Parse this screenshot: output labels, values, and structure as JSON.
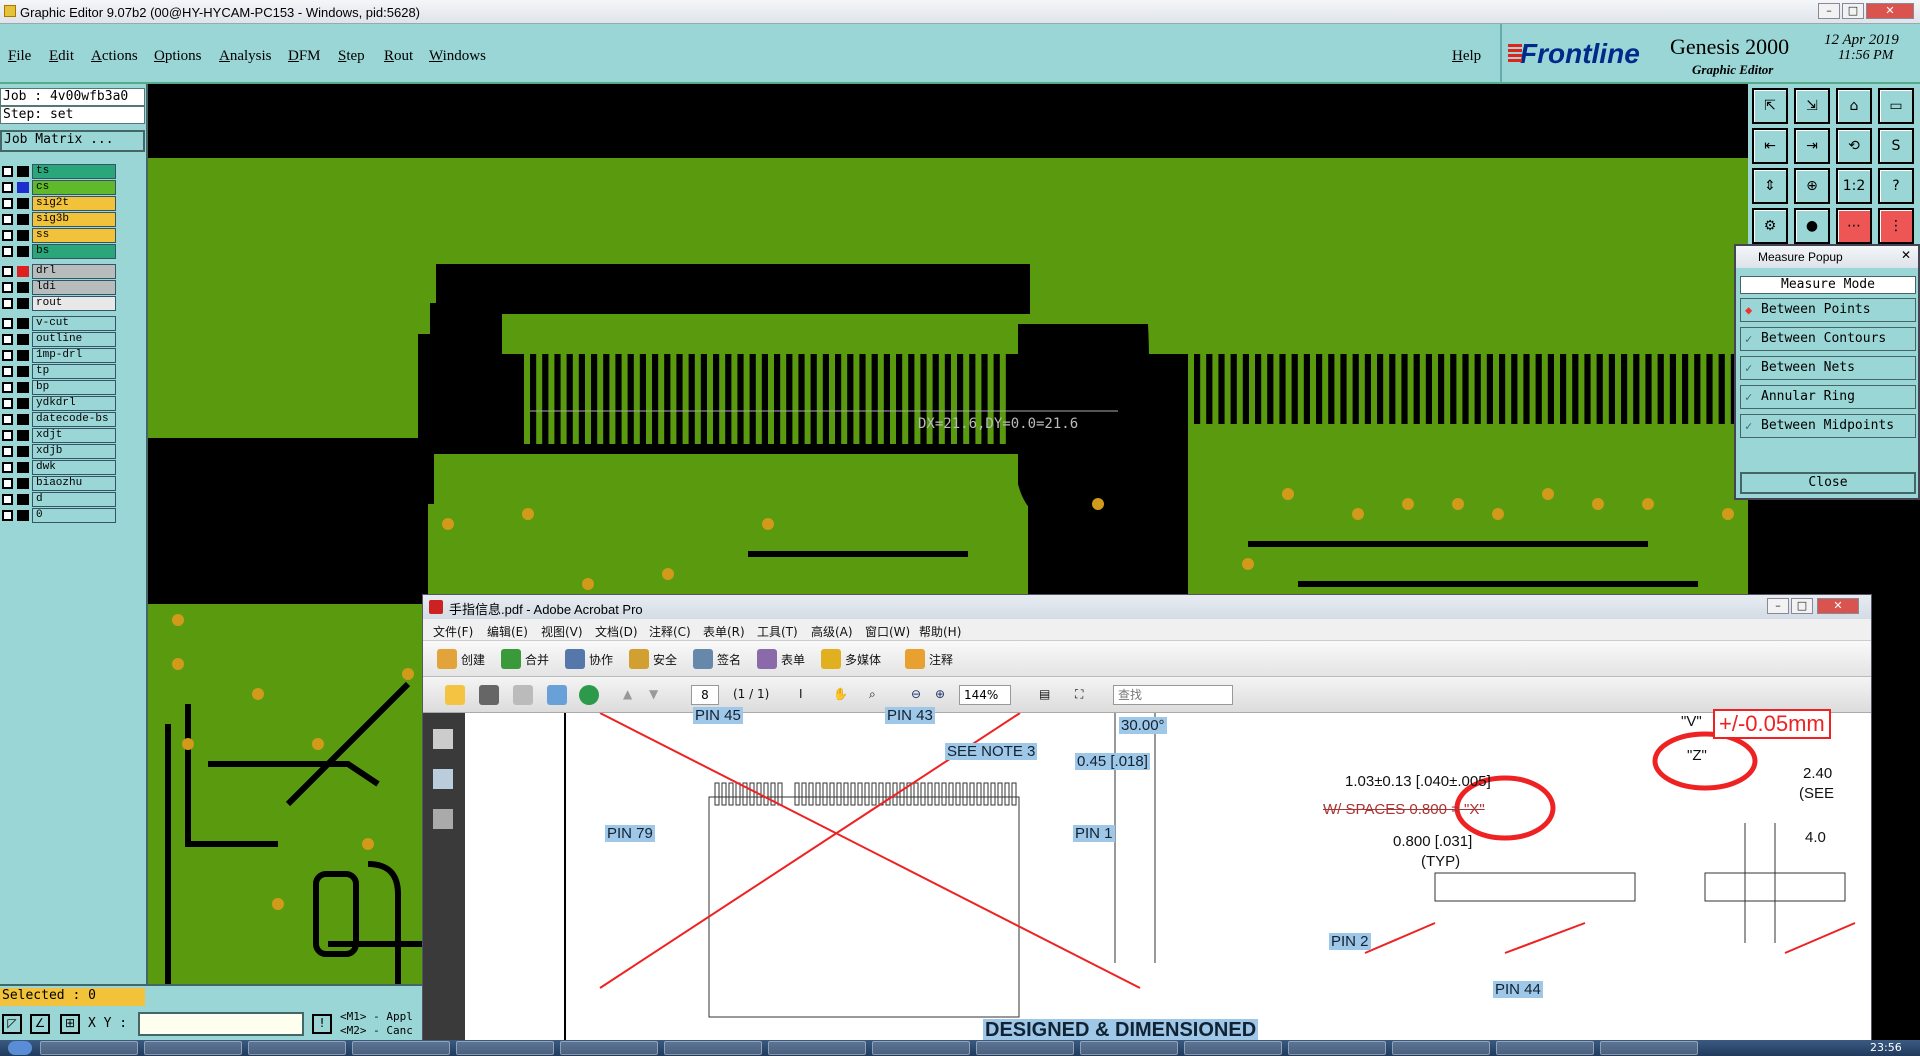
{
  "window": {
    "title": "Graphic Editor 9.07b2 (00@HY-HYCAM-PC153 - Windows, pid:5628)"
  },
  "menu": [
    "File",
    "Edit",
    "Actions",
    "Options",
    "Analysis",
    "DFM",
    "Step",
    "Rout",
    "Windows"
  ],
  "help_label": "Help",
  "brand": {
    "logo": "Frontline",
    "product": "Genesis 2000",
    "subtitle": "Graphic Editor",
    "date": "12 Apr 2019",
    "time": "11:56 PM"
  },
  "job": {
    "job_line": "Job : 4v00wfb3a0",
    "step_line": "Step: set",
    "matrix_button": "Job Matrix ..."
  },
  "layers": [
    {
      "name": "ts",
      "color": "#2aa67a"
    },
    {
      "name": "cs",
      "color": "#5fb92a"
    },
    {
      "name": "sig2t",
      "color": "#f2c23a"
    },
    {
      "name": "sig3b",
      "color": "#f2c23a"
    },
    {
      "name": "ss",
      "color": "#f2c23a"
    },
    {
      "name": "bs",
      "color": "#2aa67a"
    },
    {
      "name": "drl",
      "color": "#b9bcbc"
    },
    {
      "name": "ldi",
      "color": "#b9bcbc"
    },
    {
      "name": "rout",
      "color": "#e8e8e8"
    },
    {
      "name": "v-cut",
      "color": "#9bd6d6"
    },
    {
      "name": "outline",
      "color": "#9bd6d6"
    },
    {
      "name": "1mp-drl",
      "color": "#9bd6d6"
    },
    {
      "name": "tp",
      "color": "#9bd6d6"
    },
    {
      "name": "bp",
      "color": "#9bd6d6"
    },
    {
      "name": "ydkdrl",
      "color": "#9bd6d6"
    },
    {
      "name": "datecode-bs",
      "color": "#9bd6d6"
    },
    {
      "name": "xdjt",
      "color": "#9bd6d6"
    },
    {
      "name": "xdjb",
      "color": "#9bd6d6"
    },
    {
      "name": "dwk",
      "color": "#9bd6d6"
    },
    {
      "name": "biaozhu",
      "color": "#9bd6d6"
    },
    {
      "name": "d",
      "color": "#9bd6d6"
    },
    {
      "name": "0",
      "color": "#9bd6d6"
    }
  ],
  "canvas": {
    "measure_text": "DX=21.6,DY=0.0=21.6"
  },
  "status": {
    "selected": "Selected : 0",
    "xy_label": "X Y :",
    "xy_value": "",
    "m1": "<M1> - Appl",
    "m2": "<M2> - Canc"
  },
  "measure_popup": {
    "title": "Measure Popup",
    "mode_header": "Measure Mode",
    "options": [
      {
        "label": "Between Points",
        "selected": true
      },
      {
        "label": "Between Contours",
        "selected": false
      },
      {
        "label": "Between Nets",
        "selected": false
      },
      {
        "label": "Annular Ring",
        "selected": false
      },
      {
        "label": "Between Midpoints",
        "selected": false
      }
    ],
    "close": "Close"
  },
  "tool_icons": [
    "frame-up-icon",
    "frame-down-icon",
    "home-icon",
    "window-icon",
    "frame-left-icon",
    "frame-right-icon",
    "pan-icon",
    "s-icon",
    "fit-icon",
    "zoom-icon",
    "ratio-icon",
    "help-icon",
    "snap-icon",
    "measure-icon",
    "net-icon",
    "net2-icon"
  ],
  "tool_labels": {
    "ratio": "1:2",
    "help": "?",
    "s": "S"
  },
  "acrobat": {
    "title": "手指信息.pdf - Adobe Acrobat Pro",
    "menu": [
      "文件(F)",
      "编辑(E)",
      "视图(V)",
      "文档(D)",
      "注释(C)",
      "表单(R)",
      "工具(T)",
      "高级(A)",
      "窗口(W)",
      "帮助(H)"
    ],
    "toolbar": [
      "创建",
      "合并",
      "协作",
      "安全",
      "签名",
      "表单",
      "多媒体",
      "注释"
    ],
    "page_num": "8",
    "page_total": "(1 / 1)",
    "zoom": "144%",
    "search_placeholder": "查找",
    "doc_labels": {
      "pin45a": "PIN 45",
      "pin43": "PIN 43",
      "see_note": "SEE NOTE 3",
      "pin79": "PIN 79",
      "pin1": "PIN 1",
      "angle": "30.00°",
      "dim045": "0.45 [.018]",
      "dim103": "1.03±0.13 [.040±.005]",
      "spaces": "W/ SPACES 0.800 = \"X\"",
      "dim0800": "0.800 [.031]",
      "typ": "(TYP)",
      "v": "\"V\"",
      "tol": "+/-0.05mm",
      "z": "\"Z\"",
      "d240": "2.40",
      "see": "(SEE",
      "d40": "4.0",
      "pin2": "PIN 2",
      "pin44": "PIN 44",
      "designed": "DESIGNED & DIMENSIONED"
    }
  },
  "taskbar": {
    "time": "23:56"
  }
}
